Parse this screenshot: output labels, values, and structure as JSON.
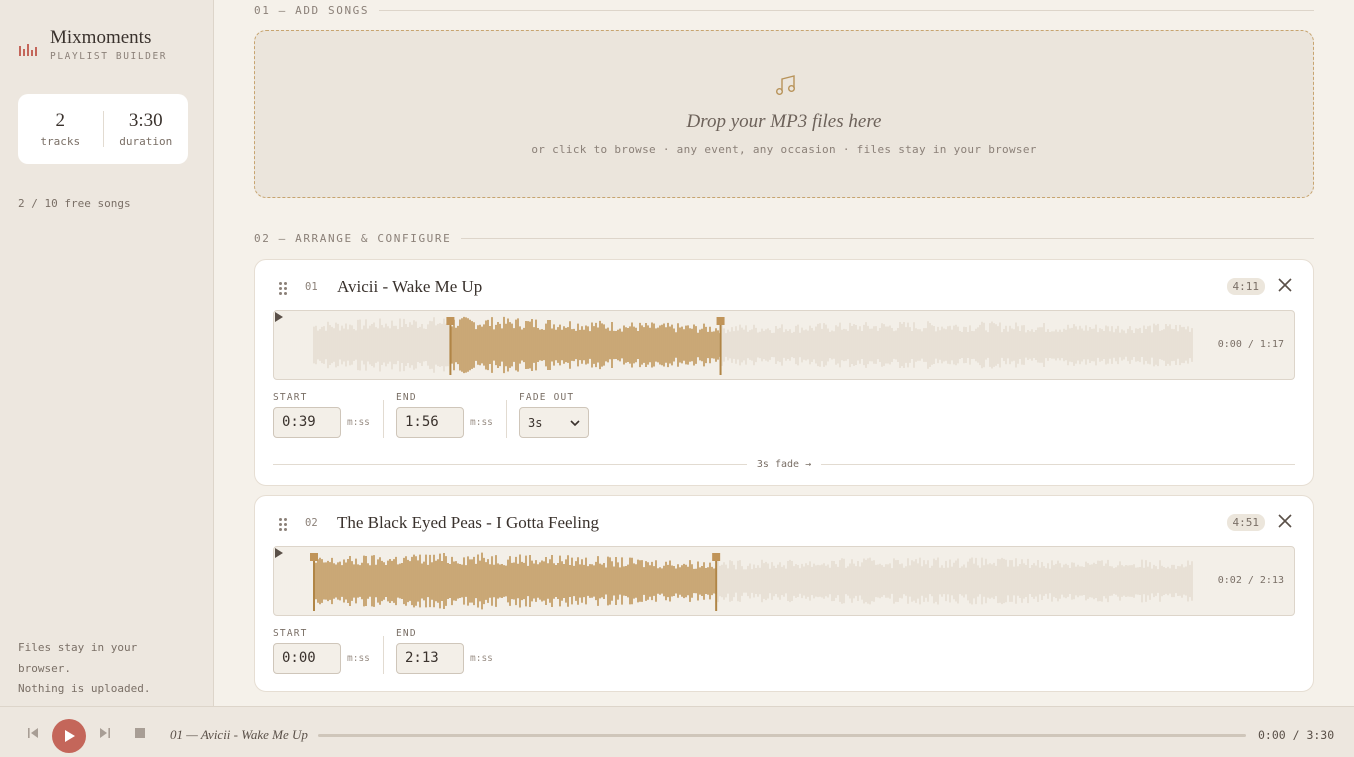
{
  "brand": {
    "name": "Mixmoments",
    "subtitle": "PLAYLIST BUILDER"
  },
  "stats": {
    "tracks_value": "2",
    "tracks_label": "tracks",
    "duration_value": "3:30",
    "duration_label": "duration"
  },
  "quota": "2 / 10 free songs",
  "privacy": {
    "line1": "Files stay in your browser.",
    "line2": "Nothing is uploaded."
  },
  "sections": {
    "add": "01 — ADD SONGS",
    "arrange": "02 — ARRANGE & CONFIGURE"
  },
  "dropzone": {
    "title": "Drop your MP3 files here",
    "subtitle": "or click to browse · any event, any occasion · files stay in your browser"
  },
  "tracks": [
    {
      "number": "01",
      "title": "Avicii - Wake Me Up",
      "duration": "4:11",
      "wave_time": "0:00 / 1:17",
      "start_label": "START",
      "start": "0:39",
      "start_unit": "m:ss",
      "end_label": "END",
      "end": "1:56",
      "end_unit": "m:ss",
      "fade_label": "FADE OUT",
      "fade": "3s",
      "transition": "3s fade →",
      "selection_start": 0.155,
      "selection_end": 0.462
    },
    {
      "number": "02",
      "title": "The Black Eyed Peas - I Gotta Feeling",
      "duration": "4:51",
      "wave_time": "0:02 / 2:13",
      "start_label": "START",
      "start": "0:00",
      "start_unit": "m:ss",
      "end_label": "END",
      "end": "2:13",
      "end_unit": "m:ss",
      "selection_start": 0.0,
      "selection_end": 0.457
    }
  ],
  "player": {
    "now_playing": "01 — Avicii - Wake Me Up",
    "time": "0:00 / 3:30",
    "progress": 0
  },
  "colors": {
    "accent": "#c09459",
    "play": "#c4665a",
    "background": "#f5f1ea",
    "sidebar": "#ede7df"
  }
}
